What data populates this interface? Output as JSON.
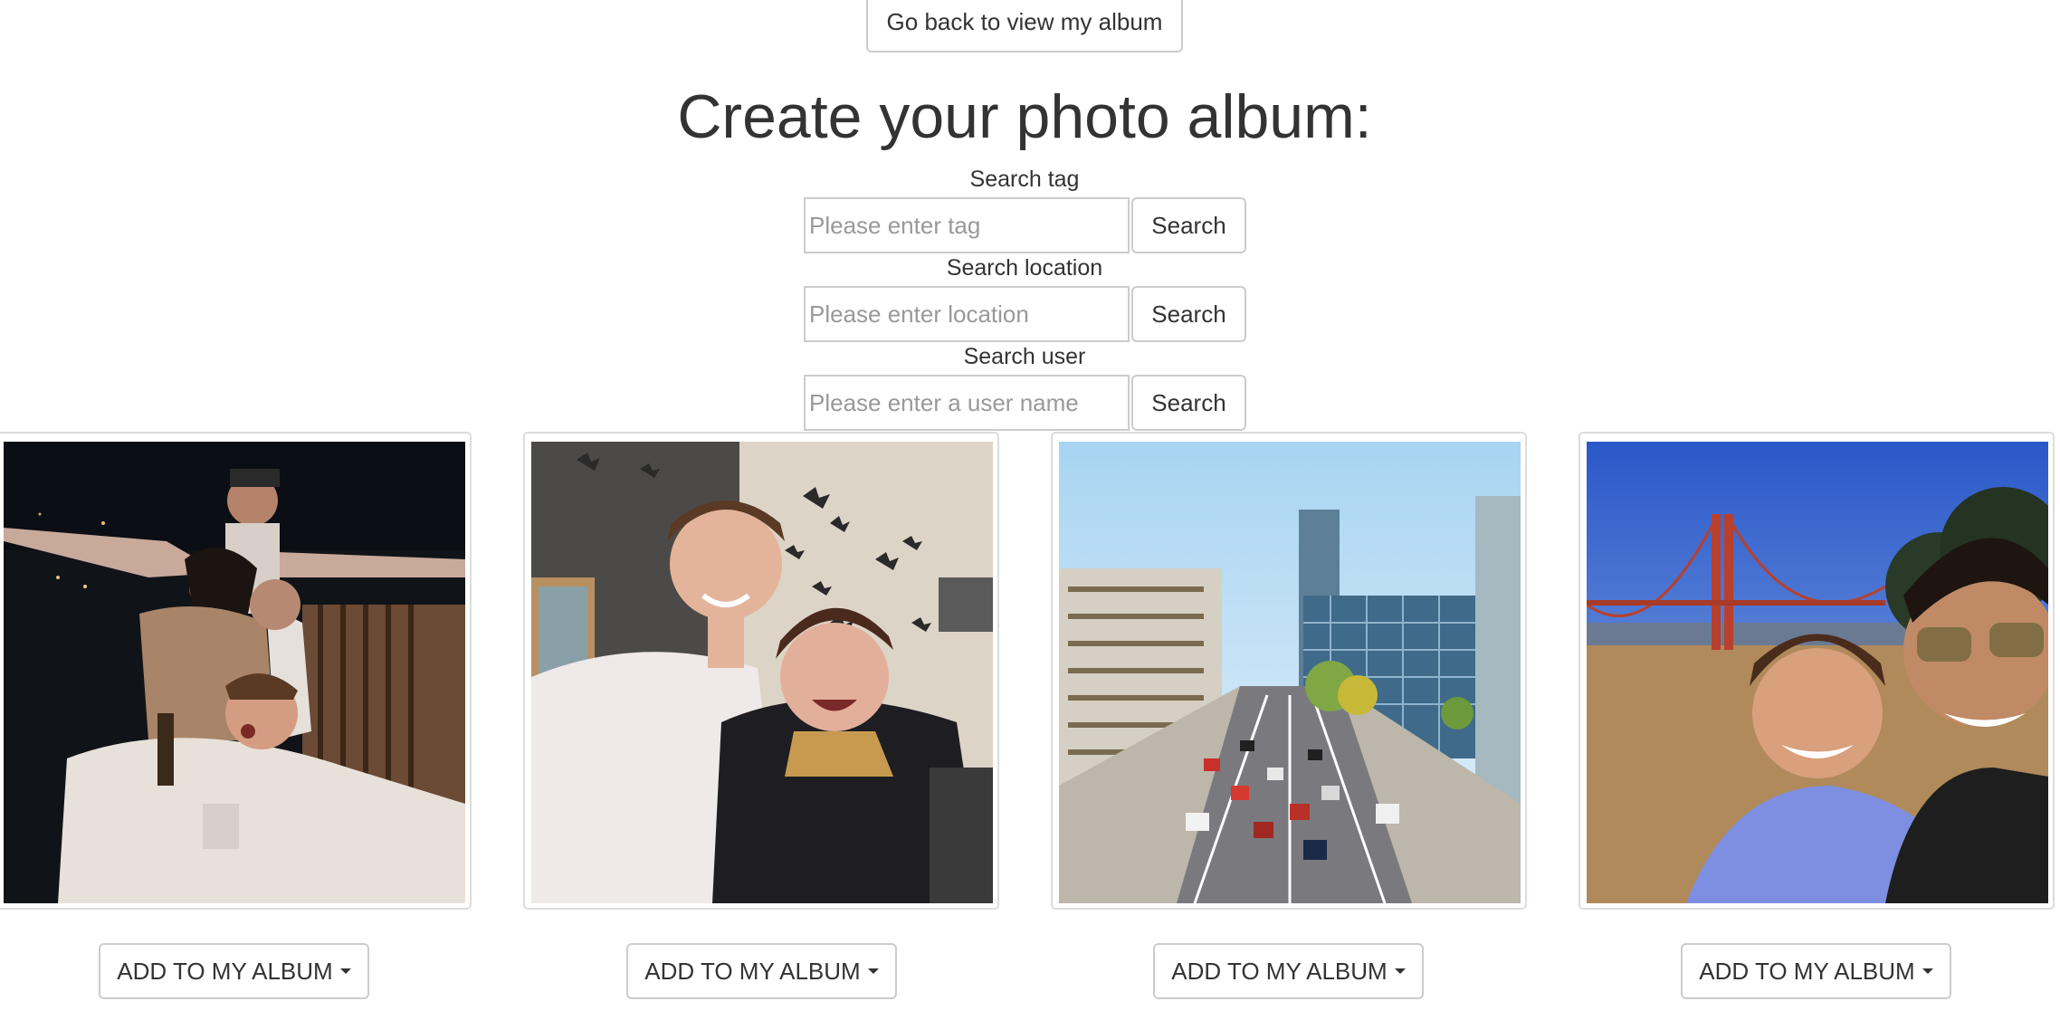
{
  "header": {
    "back_button_label": "Go back to view my album",
    "title": "Create your photo album:"
  },
  "search": {
    "tag": {
      "label": "Search tag",
      "placeholder": "Please enter tag",
      "value": "",
      "button_label": "Search"
    },
    "location": {
      "label": "Search location",
      "placeholder": "Please enter location",
      "value": "",
      "button_label": "Search"
    },
    "user": {
      "label": "Search user",
      "placeholder": "Please enter a user name",
      "value": "",
      "button_label": "Search"
    }
  },
  "photos": [
    {
      "button_label": "ADD TO MY ALBUM",
      "icon": "caret-down-icon"
    },
    {
      "button_label": "ADD TO MY ALBUM",
      "icon": "caret-down-icon"
    },
    {
      "button_label": "ADD TO MY ALBUM",
      "icon": "caret-down-icon"
    },
    {
      "button_label": "ADD TO MY ALBUM",
      "icon": "caret-down-icon"
    }
  ],
  "colors": {
    "button_border": "#cccccc",
    "text": "#333333",
    "placeholder": "#999999"
  }
}
